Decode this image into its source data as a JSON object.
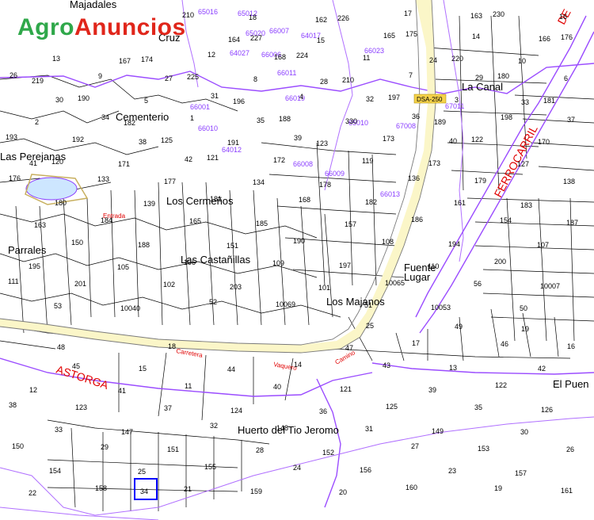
{
  "logo": {
    "part1": "Agro",
    "part2": "Anuncios"
  },
  "place_names": [
    {
      "key": "majadales",
      "text": "Majadales"
    },
    {
      "key": "cruz",
      "text": "Cruz"
    },
    {
      "key": "cementerio",
      "text": "Cementerio"
    },
    {
      "key": "las_perejanas",
      "text": "Las Perejanas"
    },
    {
      "key": "los_cermenos",
      "text": "Los Cermeños"
    },
    {
      "key": "las_castanillas",
      "text": "Las Castañillas"
    },
    {
      "key": "parrales",
      "text": "Parrales"
    },
    {
      "key": "la_canal",
      "text": "La Canal"
    },
    {
      "key": "fuente_lugar",
      "text": "Fuente\nLugar"
    },
    {
      "key": "los_majanos",
      "text": "Los Majanos"
    },
    {
      "key": "el_puen",
      "text": "El Puen"
    },
    {
      "key": "huerto",
      "text": "Huerto del Tio Jeromo"
    }
  ],
  "red_labels": [
    {
      "key": "astorga",
      "text": "ASTORGA"
    },
    {
      "key": "ferrocarril",
      "text": "FERROCARRIL"
    },
    {
      "key": "de",
      "text": "DE"
    },
    {
      "key": "entrada",
      "text": "Entrada"
    },
    {
      "key": "carretera",
      "text": "Carretera"
    },
    {
      "key": "camino",
      "text": "Camino"
    },
    {
      "key": "vaquero",
      "text": "Vaquero"
    }
  ],
  "road_badge": "DSA-250",
  "highlighted_parcel": "34",
  "polygon_ids": [
    "66023",
    "65010",
    "67008",
    "67011",
    "66013",
    "66011",
    "66006",
    "66019",
    "64012",
    "65012",
    "66007",
    "66008",
    "66009",
    "66010",
    "66001",
    "65016",
    "65020",
    "64017",
    "64027"
  ],
  "parcel_numbers": [
    "210",
    "226",
    "230",
    "227",
    "175",
    "176",
    "174",
    "224",
    "220",
    "219",
    "225",
    "210",
    "180",
    "190",
    "196",
    "197",
    "181",
    "182",
    "188",
    "189",
    "193",
    "125",
    "123",
    "122",
    "120",
    "121",
    "119",
    "127",
    "133",
    "134",
    "136",
    "138",
    "139",
    "168",
    "161",
    "163",
    "165",
    "157",
    "154",
    "150",
    "151",
    "108",
    "107",
    "105",
    "109",
    "110",
    "111",
    "102",
    "101",
    "56",
    "53",
    "52",
    "51",
    "50",
    "49",
    "48",
    "47",
    "46",
    "45",
    "44",
    "43",
    "42",
    "41",
    "40",
    "39",
    "38",
    "37",
    "36",
    "35",
    "33",
    "32",
    "31",
    "30",
    "29",
    "28",
    "27",
    "26",
    "25",
    "24",
    "23",
    "22",
    "21",
    "20",
    "19",
    "18",
    "17",
    "16",
    "15",
    "14",
    "13",
    "12",
    "11",
    "10",
    "9",
    "8",
    "7",
    "6",
    "5",
    "4",
    "3",
    "2",
    "1",
    "330",
    "198",
    "192",
    "191",
    "173",
    "170",
    "171",
    "172",
    "173",
    "176",
    "177",
    "178",
    "179",
    "180",
    "181",
    "182",
    "183",
    "184",
    "185",
    "186",
    "187",
    "188",
    "190",
    "194",
    "195",
    "196",
    "197",
    "200",
    "201",
    "203",
    "10065",
    "10007",
    "10040",
    "10069",
    "10053",
    "25",
    "19",
    "18",
    "17",
    "16",
    "15",
    "14",
    "13",
    "12",
    "11",
    "121",
    "122",
    "123",
    "124",
    "125",
    "126",
    "147",
    "148",
    "149",
    "150",
    "151",
    "152",
    "153",
    "154",
    "155",
    "156",
    "157",
    "158",
    "159",
    "160",
    "161",
    "162",
    "163",
    "164",
    "165",
    "166",
    "167",
    "168",
    "24",
    "26",
    "27",
    "28",
    "29",
    "30",
    "31",
    "32",
    "33",
    "34",
    "35",
    "36",
    "37",
    "38",
    "39",
    "40",
    "41",
    "42"
  ]
}
